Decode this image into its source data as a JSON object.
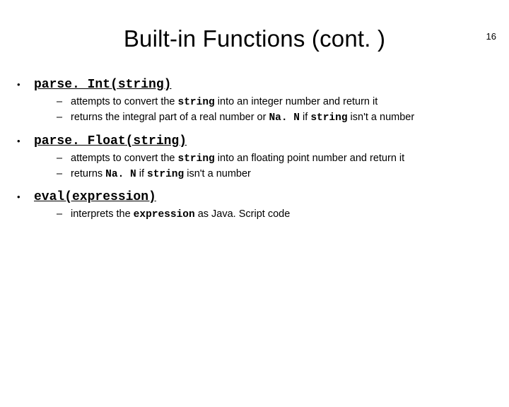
{
  "page_number": "16",
  "title": "Built-in Functions (cont. )",
  "items": [
    {
      "label": "parse. Int(string)",
      "subs": [
        {
          "pre": "attempts to convert the ",
          "mono": "string",
          "post": " into an integer number and return it"
        },
        {
          "pre": "returns the integral part of a real number or ",
          "mono": "Na. N",
          "post_pre": " if ",
          "mono2": "string",
          "post": " isn't a number"
        }
      ]
    },
    {
      "label": "parse. Float(string)",
      "subs": [
        {
          "pre": "attempts to convert the ",
          "mono": "string",
          "post": " into an floating point number and return it"
        },
        {
          "pre": "returns ",
          "mono": "Na. N",
          "post_pre": " if ",
          "mono2": "string",
          "post": " isn't a number"
        }
      ]
    },
    {
      "label": "eval(expression)",
      "subs": [
        {
          "pre": "interprets the ",
          "mono": "expression",
          "post": " as Java. Script code"
        }
      ]
    }
  ]
}
